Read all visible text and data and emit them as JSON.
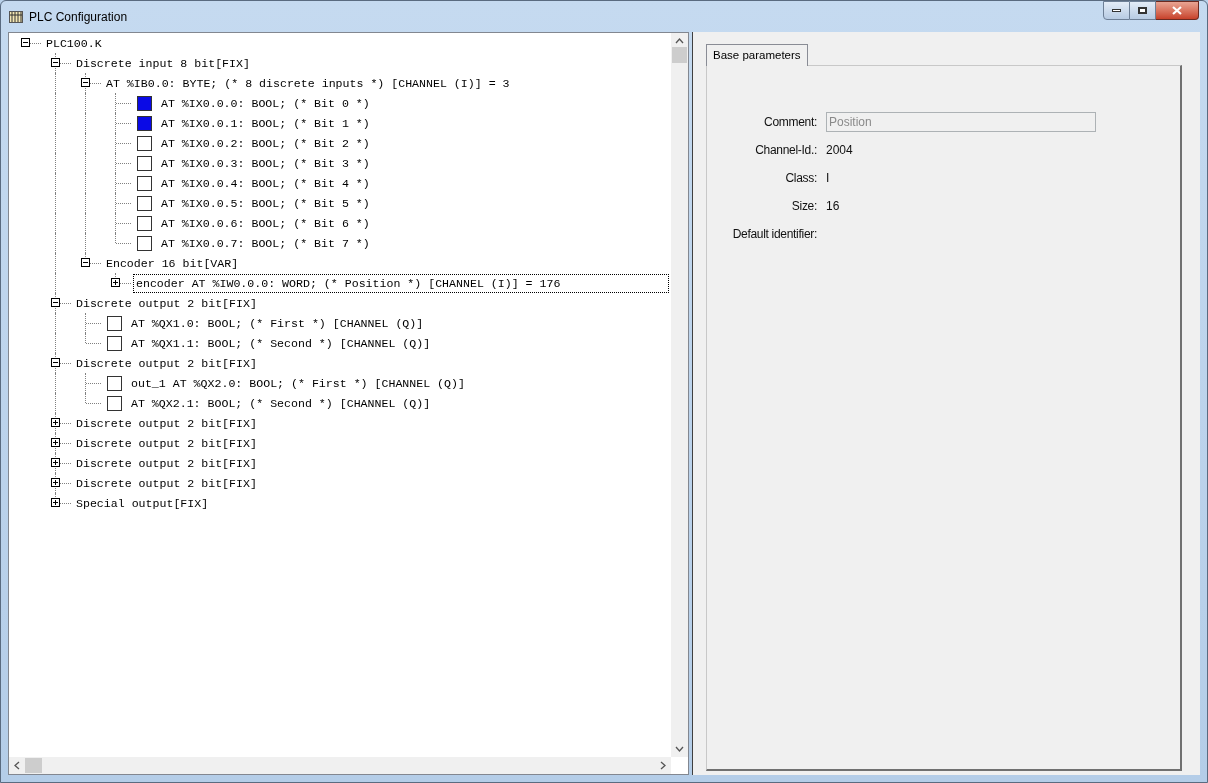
{
  "window": {
    "title": "PLC Configuration"
  },
  "tree": [
    {
      "label": "PLC100.K",
      "expanded": true,
      "selected": false,
      "children": [
        {
          "label": "Discrete input 8 bit[FIX]",
          "expanded": true,
          "selected": false,
          "children": [
            {
              "label": "AT %IB0.0: BYTE; (* 8 discrete inputs *) [CHANNEL (I)] = 3",
              "expanded": true,
              "selected": false,
              "children": [
                {
                  "kind": "channel",
                  "label": "AT %IX0.0.0: BOOL; (* Bit 0 *)",
                  "checked": true,
                  "selected": false
                },
                {
                  "kind": "channel",
                  "label": "AT %IX0.0.1: BOOL; (* Bit 1 *)",
                  "checked": true,
                  "selected": false
                },
                {
                  "kind": "channel",
                  "label": "AT %IX0.0.2: BOOL; (* Bit 2 *)",
                  "checked": false,
                  "selected": false
                },
                {
                  "kind": "channel",
                  "label": "AT %IX0.0.3: BOOL; (* Bit 3 *)",
                  "checked": false,
                  "selected": false
                },
                {
                  "kind": "channel",
                  "label": "AT %IX0.0.4: BOOL; (* Bit 4 *)",
                  "checked": false,
                  "selected": false
                },
                {
                  "kind": "channel",
                  "label": "AT %IX0.0.5: BOOL; (* Bit 5 *)",
                  "checked": false,
                  "selected": false
                },
                {
                  "kind": "channel",
                  "label": "AT %IX0.0.6: BOOL; (* Bit 6 *)",
                  "checked": false,
                  "selected": false
                },
                {
                  "kind": "channel",
                  "label": "AT %IX0.0.7: BOOL; (* Bit 7 *)",
                  "checked": false,
                  "selected": false
                }
              ]
            },
            {
              "label": "Encoder 16 bit[VAR]",
              "expanded": true,
              "selected": false,
              "children": [
                {
                  "label": "encoder AT %IW0.0.0: WORD; (* Position *) [CHANNEL (I)] = 176",
                  "expanded": false,
                  "selected": true
                }
              ]
            }
          ]
        },
        {
          "label": "Discrete output 2 bit[FIX]",
          "expanded": true,
          "selected": false,
          "children": [
            {
              "kind": "channel",
              "label": "AT %QX1.0: BOOL; (* First *) [CHANNEL (Q)]",
              "checked": false,
              "selected": false
            },
            {
              "kind": "channel",
              "label": "AT %QX1.1: BOOL; (* Second *) [CHANNEL (Q)]",
              "checked": false,
              "selected": false
            }
          ]
        },
        {
          "label": "Discrete output 2 bit[FIX]",
          "expanded": true,
          "selected": false,
          "children": [
            {
              "kind": "channel",
              "label": "out_1 AT %QX2.0: BOOL; (* First *) [CHANNEL (Q)]",
              "checked": false,
              "selected": false
            },
            {
              "kind": "channel",
              "label": "AT %QX2.1: BOOL; (* Second *) [CHANNEL (Q)]",
              "checked": false,
              "selected": false
            }
          ]
        },
        {
          "label": "Discrete output 2 bit[FIX]",
          "expanded": false,
          "selected": false
        },
        {
          "label": "Discrete output 2 bit[FIX]",
          "expanded": false,
          "selected": false
        },
        {
          "label": "Discrete output 2 bit[FIX]",
          "expanded": false,
          "selected": false
        },
        {
          "label": "Discrete output 2 bit[FIX]",
          "expanded": false,
          "selected": false
        },
        {
          "label": "Special output[FIX]",
          "expanded": false,
          "selected": false
        }
      ]
    }
  ],
  "tabs": [
    {
      "label": "Base parameters",
      "selected": true
    }
  ],
  "fields": [
    {
      "kind": "input",
      "label": "Comment:",
      "value": "Position",
      "disabled": true
    },
    {
      "kind": "text",
      "label": "Channel-Id.:",
      "value": "2004"
    },
    {
      "kind": "text",
      "label": "Class:",
      "value": "I"
    },
    {
      "kind": "text",
      "label": "Size:",
      "value": "16"
    },
    {
      "kind": "text",
      "label": "Default identifier:"
    }
  ]
}
